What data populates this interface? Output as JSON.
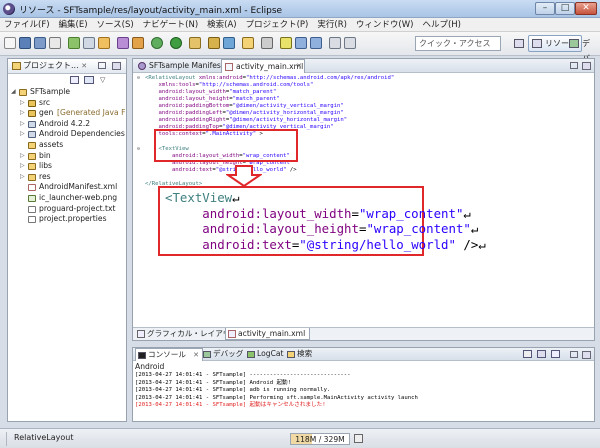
{
  "window": {
    "title": "リソース - SFTsample/res/layout/activity_main.xml - Eclipse",
    "controls": [
      "–",
      "□",
      "✕"
    ]
  },
  "menu": [
    "ファイル(F)",
    "編集(E)",
    "ソース(S)",
    "ナビゲート(N)",
    "検索(A)",
    "プロジェクト(P)",
    "実行(R)",
    "ウィンドウ(W)",
    "ヘルプ(H)"
  ],
  "toolbar": {
    "quick_access_placeholder": "クイック・アクセス",
    "perspectives": [
      "リソース",
      "デバッグ"
    ]
  },
  "project_explorer": {
    "tab_label": "プロジェクト...",
    "tree": [
      {
        "label": "SFTsample",
        "level": 0,
        "expanded": true,
        "icon": "project-icon"
      },
      {
        "label": "src",
        "level": 1,
        "expanded": false,
        "icon": "package-folder-icon"
      },
      {
        "label": "gen",
        "suffix": "[Generated Java F",
        "level": 1,
        "expanded": false,
        "icon": "package-folder-icon"
      },
      {
        "label": "Android 4.2.2",
        "level": 1,
        "expanded": false,
        "icon": "library-icon"
      },
      {
        "label": "Android Dependencies",
        "level": 1,
        "expanded": false,
        "icon": "library-icon"
      },
      {
        "label": "assets",
        "level": 1,
        "expanded": null,
        "icon": "folder-icon"
      },
      {
        "label": "bin",
        "level": 1,
        "expanded": false,
        "icon": "folder-icon"
      },
      {
        "label": "libs",
        "level": 1,
        "expanded": false,
        "icon": "folder-icon"
      },
      {
        "label": "res",
        "level": 1,
        "expanded": false,
        "icon": "folder-icon"
      },
      {
        "label": "AndroidManifest.xml",
        "level": 1,
        "expanded": null,
        "icon": "xml-file-icon"
      },
      {
        "label": "ic_launcher-web.png",
        "level": 1,
        "expanded": null,
        "icon": "image-file-icon"
      },
      {
        "label": "proguard-project.txt",
        "level": 1,
        "expanded": null,
        "icon": "text-file-icon"
      },
      {
        "label": "project.properties",
        "level": 1,
        "expanded": null,
        "icon": "properties-file-icon"
      }
    ]
  },
  "editor": {
    "tabs": [
      {
        "label": "SFTsample Manifest",
        "selected": false
      },
      {
        "label": "activity_main.xml",
        "selected": true
      }
    ],
    "code_lines": [
      [
        [
          "t-tag",
          "<RelativeLayout "
        ],
        [
          "t-attr",
          "xmlns:android"
        ],
        [
          "t-p",
          "="
        ],
        [
          "t-val",
          "\"http://schemas.android.com/apk/res/android\""
        ]
      ],
      [
        [
          "t-attr",
          "    xmlns:tools"
        ],
        [
          "t-p",
          "="
        ],
        [
          "t-val",
          "\"http://schemas.android.com/tools\""
        ]
      ],
      [
        [
          "t-attr",
          "    android:layout_width"
        ],
        [
          "t-p",
          "="
        ],
        [
          "t-val",
          "\"match_parent\""
        ]
      ],
      [
        [
          "t-attr",
          "    android:layout_height"
        ],
        [
          "t-p",
          "="
        ],
        [
          "t-val",
          "\"match_parent\""
        ]
      ],
      [
        [
          "t-attr",
          "    android:paddingBottom"
        ],
        [
          "t-p",
          "="
        ],
        [
          "t-val",
          "\"@dimen/activity_vertical_margin\""
        ]
      ],
      [
        [
          "t-attr",
          "    android:paddingLeft"
        ],
        [
          "t-p",
          "="
        ],
        [
          "t-val",
          "\"@dimen/activity_horizontal_margin\""
        ]
      ],
      [
        [
          "t-attr",
          "    android:paddingRight"
        ],
        [
          "t-p",
          "="
        ],
        [
          "t-val",
          "\"@dimen/activity_horizontal_margin\""
        ]
      ],
      [
        [
          "t-attr",
          "    android:paddingTop"
        ],
        [
          "t-p",
          "="
        ],
        [
          "t-val",
          "\"@dimen/activity_vertical_margin\""
        ]
      ],
      [
        [
          "t-attr",
          "    tools:context"
        ],
        [
          "t-p",
          "="
        ],
        [
          "t-val",
          "\".MainActivity\""
        ],
        [
          "t-p",
          " >"
        ]
      ],
      [
        [
          "t-p",
          ""
        ]
      ],
      [
        [
          "t-tag",
          "    <TextView"
        ]
      ],
      [
        [
          "t-attr",
          "        android:layout_width"
        ],
        [
          "t-p",
          "="
        ],
        [
          "t-val",
          "\"wrap_content\""
        ]
      ],
      [
        [
          "t-attr",
          "        android:layout_height"
        ],
        [
          "t-p",
          "="
        ],
        [
          "t-val",
          "\"wrap_content\""
        ]
      ],
      [
        [
          "t-attr",
          "        android:text"
        ],
        [
          "t-p",
          "="
        ],
        [
          "t-val",
          "\"@string/hello_world\""
        ],
        [
          "t-p",
          " />"
        ]
      ],
      [
        [
          "t-p",
          ""
        ]
      ],
      [
        [
          "t-tag",
          "</RelativeLayout>"
        ]
      ]
    ],
    "bottom_tabs": [
      "グラフィカル・レイアウト",
      "activity_main.xml"
    ]
  },
  "callout": {
    "lines": [
      [
        [
          "t-tag",
          "<TextView"
        ],
        [
          "t-p",
          "↵"
        ]
      ],
      [
        [
          "t-attr",
          "     android:layout_width"
        ],
        [
          "t-p",
          "="
        ],
        [
          "t-val",
          "\"wrap_content\""
        ],
        [
          "t-p",
          "↵"
        ]
      ],
      [
        [
          "t-attr",
          "     android:layout_height"
        ],
        [
          "t-p",
          "="
        ],
        [
          "t-val",
          "\"wrap_content\""
        ],
        [
          "t-p",
          "↵"
        ]
      ],
      [
        [
          "t-attr",
          "     android:text"
        ],
        [
          "t-p",
          "="
        ],
        [
          "t-val",
          "\"@string/hello_world\""
        ],
        [
          "t-p",
          " />↵"
        ]
      ]
    ]
  },
  "console": {
    "tabs": [
      "コンソール",
      "デバッグ",
      "LogCat",
      "検索"
    ],
    "label": "Android",
    "lines": [
      {
        "text": "[2013-04-27 14:01:41 - SFTsample] ------------------------------",
        "color": "#000000"
      },
      {
        "text": "[2013-04-27 14:01:41 - SFTsample] Android 起動!",
        "color": "#000000"
      },
      {
        "text": "[2013-04-27 14:01:41 - SFTsample] adb is running normally.",
        "color": "#000000"
      },
      {
        "text": "[2013-04-27 14:01:41 - SFTsample] Performing sft.sample.MainActivity activity launch",
        "color": "#000000"
      },
      {
        "text": "[2013-04-27 14:01:41 - SFTsample] 起動はキャンセルされました!",
        "color": "#e02020"
      }
    ]
  },
  "status": {
    "selection": "RelativeLayout",
    "heap": "118M / 329M",
    "heap_fraction": 0.36
  },
  "colors": {
    "highlight": "#e0272a",
    "xml_tag": "#3f7f7f",
    "xml_attr": "#7f007f",
    "xml_value": "#2a00ff"
  }
}
